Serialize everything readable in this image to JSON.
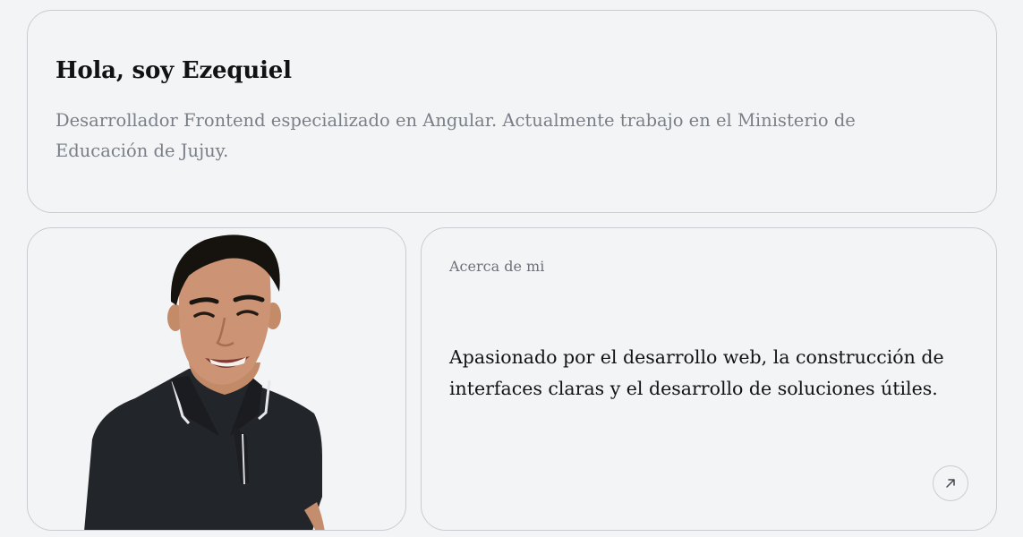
{
  "hero": {
    "title": "Hola, soy Ezequiel",
    "subtitle": "Desarrollador Frontend especializado en Angular. Actualmente trabajo en el Ministerio de Educación de Jujuy."
  },
  "about": {
    "label": "Acerca de mi",
    "text": "Apasionado por el desarrollo web, la construcción de interfaces claras y el desarrollo de soluciones útiles.",
    "link_icon": "arrow-up-right-icon"
  },
  "photo": {
    "icon": "profile-photo"
  },
  "colors": {
    "background": "#f3f4f6",
    "border": "#c9ccd1",
    "title": "#111214",
    "muted": "#7a7f87",
    "shirt": "#23262b"
  }
}
